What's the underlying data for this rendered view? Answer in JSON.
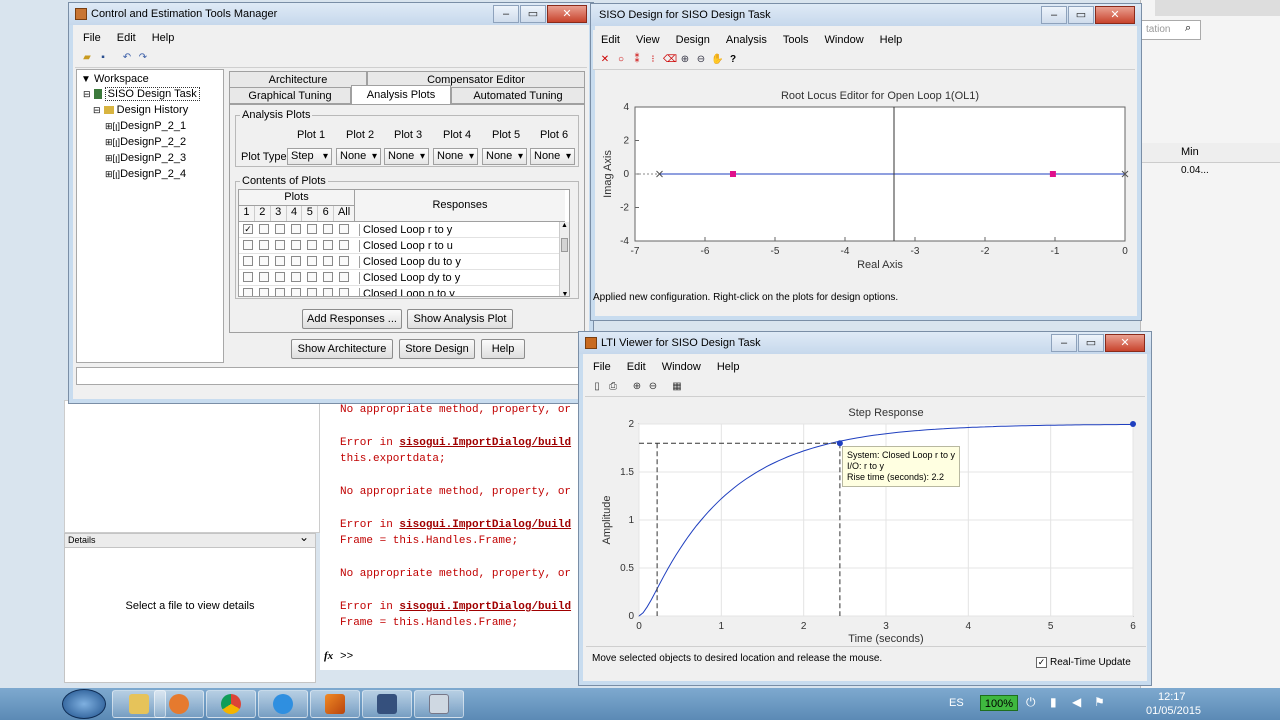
{
  "ctm": {
    "title": "Control and Estimation Tools Manager",
    "menu": [
      "File",
      "Edit",
      "Help"
    ],
    "tree": {
      "root": "Workspace",
      "task": "SISO Design Task",
      "history": "Design History",
      "designs": [
        "DesignP_2_1",
        "DesignP_2_2",
        "DesignP_2_3",
        "DesignP_2_4"
      ]
    },
    "tabs_row1": [
      "Architecture",
      "Compensator Editor"
    ],
    "tabs_row2": [
      "Graphical Tuning",
      "Analysis Plots",
      "Automated Tuning"
    ],
    "analysis_group": "Analysis Plots",
    "plot_headers": [
      "Plot 1",
      "Plot 2",
      "Plot 3",
      "Plot 4",
      "Plot 5",
      "Plot 6"
    ],
    "plot_type_label": "Plot Type",
    "plot_types": [
      "Step",
      "None",
      "None",
      "None",
      "None",
      "None"
    ],
    "contents_group": "Contents of Plots",
    "plots_header": "Plots",
    "check_cols": [
      "1",
      "2",
      "3",
      "4",
      "5",
      "6",
      "All"
    ],
    "responses_header": "Responses",
    "responses": [
      "Closed Loop r to y",
      "Closed Loop r to u",
      "Closed Loop du to y",
      "Closed Loop dy to y",
      "Closed Loop n to y"
    ],
    "add_responses": "Add Responses ...",
    "show_analysis": "Show Analysis Plot",
    "show_architecture": "Show Architecture",
    "store_design": "Store Design",
    "help": "Help"
  },
  "siso": {
    "title": "SISO Design for SISO Design Task",
    "menu": [
      "Edit",
      "View",
      "Design",
      "Analysis",
      "Tools",
      "Window",
      "Help"
    ],
    "plot_title": "Root Locus Editor for Open Loop 1(OL1)",
    "xlabel": "Real Axis",
    "ylabel": "Imag Axis",
    "xticks": [
      "-7",
      "-6",
      "-5",
      "-4",
      "-3",
      "-2",
      "-1",
      "0"
    ],
    "yticks": [
      "4",
      "2",
      "0",
      "-2",
      "-4"
    ],
    "status": "Applied new configuration. Right-click on the plots for design options.",
    "search_hint": "tation"
  },
  "lti": {
    "title": "LTI Viewer for SISO Design Task",
    "menu": [
      "File",
      "Edit",
      "Window",
      "Help"
    ],
    "status": "Move selected objects to desired location and release the mouse.",
    "realtime": "Real-Time Update",
    "tooltip": [
      "System: Closed Loop r to y",
      "I/O: r to y",
      "Rise time (seconds): 2.2"
    ]
  },
  "chart_data": [
    {
      "type": "scatter",
      "title": "Root Locus Editor for Open Loop 1(OL1)",
      "xlabel": "Real Axis",
      "ylabel": "Imag Axis",
      "xlim": [
        -7,
        0
      ],
      "ylim": [
        -4,
        4
      ],
      "series": [
        {
          "name": "poles",
          "x": [
            -6.65,
            -0.0
          ],
          "y": [
            0,
            0
          ]
        },
        {
          "name": "closed-loop poles",
          "x": [
            -5.6,
            -1.03
          ],
          "y": [
            0,
            0
          ]
        }
      ],
      "vertical_line_x": -3.3
    },
    {
      "type": "line",
      "title": "Step Response",
      "xlabel": "Time (seconds)",
      "ylabel": "Amplitude",
      "xlim": [
        0,
        6
      ],
      "ylim": [
        0,
        2
      ],
      "xticks": [
        0,
        1,
        2,
        3,
        4,
        5,
        6
      ],
      "yticks": [
        0,
        0.5,
        1,
        1.5,
        2
      ],
      "final_value": 2,
      "rise_time_start": 0.22,
      "rise_time_end": 2.44,
      "rise_level": 1.8
    }
  ],
  "console": {
    "lines": [
      "No appropriate method, property, or",
      "Error in ",
      "this.exportdata;",
      "No appropriate method, property, or",
      "Error in ",
      "Frame = this.Handles.Frame;",
      "No appropriate method, property, or",
      "Error in ",
      "Frame = this.Handles.Frame;"
    ],
    "link": "sisogui.ImportDialog/build",
    "prompt": ">>",
    "fx": "fx"
  },
  "details": {
    "header": "Details",
    "empty": "Select a file to view details"
  },
  "bg_right": {
    "min_label": "Min",
    "min_value": "0.04..."
  },
  "taskbar": {
    "lang": "ES",
    "battery": "100%",
    "time": "12:17",
    "date": "01/05/2015"
  },
  "colors": {
    "marker_magenta": "#e0108c",
    "locus_blue": "#1f3fbf",
    "error_red": "#c00000"
  }
}
